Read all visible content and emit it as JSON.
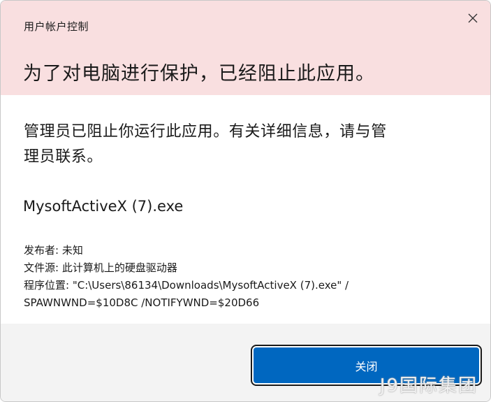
{
  "window": {
    "title": "用户帐户控制"
  },
  "header": {
    "headline": "为了对电脑进行保护，已经阻止此应用。"
  },
  "body": {
    "message": "管理员已阻止你运行此应用。有关详细信息，请与管理员联系。",
    "app_name": "MysoftActiveX (7).exe",
    "publisher_line": "发布者: 未知",
    "source_line": "文件源: 此计算机上的硬盘驱动器",
    "location_line1": "程序位置: \"C:\\Users\\86134\\Downloads\\MysoftActiveX (7).exe\" /",
    "location_line2": "SPAWNWND=$10D8C /NOTIFYWND=$20D66"
  },
  "footer": {
    "close_button_label": "关闭"
  },
  "watermark": {
    "text": "J9国际集团"
  },
  "icons": {
    "close": "close-icon"
  },
  "colors": {
    "header_bg": "#f9dfe0",
    "button_bg": "#0067c0",
    "footer_bg": "#f3f3f3"
  }
}
